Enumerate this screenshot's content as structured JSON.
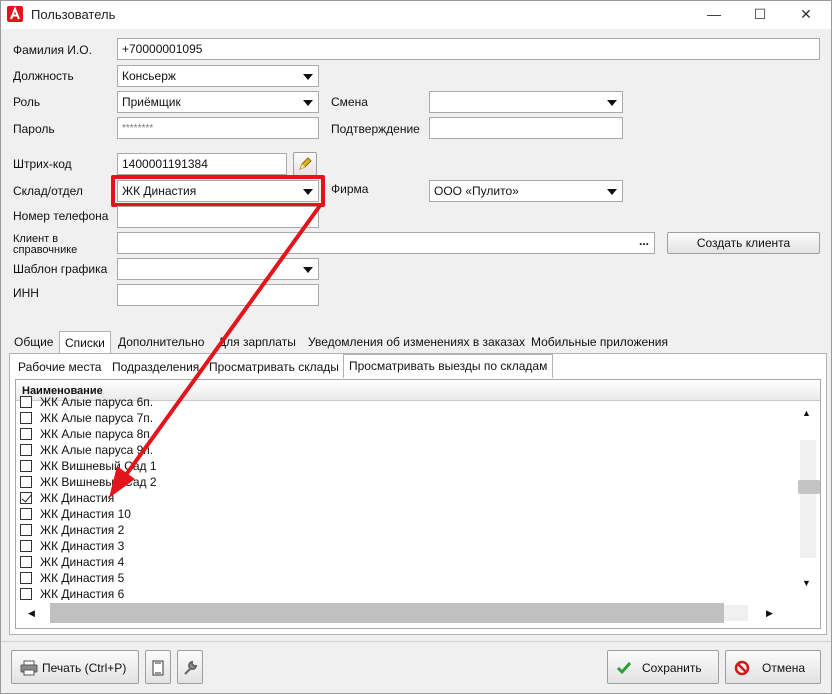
{
  "window": {
    "title": "Пользователь",
    "minimize_glyph": "—",
    "maximize_glyph": "☐",
    "close_glyph": "✕",
    "app_icon": "app-logo-icon"
  },
  "form": {
    "fio_label": "Фамилия И.О.",
    "fio_value": "+70000001095",
    "position_label": "Должность",
    "position_value": "Консьерж",
    "role_label": "Роль",
    "role_value": "Приёмщик",
    "shift_label": "Смена",
    "shift_value": "",
    "password_label": "Пароль",
    "password_value": "********",
    "confirm_label": "Подтверждение",
    "confirm_value": "",
    "barcode_label": "Штрих-код",
    "barcode_value": "1400001191384",
    "warehouse_label": "Склад/отдел",
    "warehouse_value": "ЖК Династия",
    "firm_label": "Фирма",
    "firm_value": "ООО «Пулито»",
    "phone_label": "Номер телефона",
    "phone_value": "",
    "client_label": "Клиент в справочнике",
    "client_value": "",
    "client_ellipsis": "...",
    "create_client_label": "Создать клиента",
    "schedule_label": "Шаблон графика",
    "schedule_value": "",
    "inn_label": "ИНН",
    "inn_value": ""
  },
  "tabs": [
    "Общие",
    "Списки",
    "Дополнительно",
    "Для зарплаты",
    "Уведомления об изменениях в заказах",
    "Мобильные приложения"
  ],
  "active_tab": "Списки",
  "subtabs": [
    "Рабочие места",
    "Подразделения",
    "Просматривать склады",
    "Просматривать выезды по складам"
  ],
  "active_subtab": "Просматривать выезды по складам",
  "list": {
    "header": "Наименование",
    "rows": [
      {
        "label": "ЖК Алые паруса 6п.",
        "checked": false
      },
      {
        "label": "ЖК Алые паруса 7п.",
        "checked": false
      },
      {
        "label": "ЖК Алые паруса 8п.",
        "checked": false
      },
      {
        "label": "ЖК Алые паруса 9п.",
        "checked": false
      },
      {
        "label": "ЖК Вишневый Сад 1",
        "checked": false
      },
      {
        "label": "ЖК Вишневый Сад 2",
        "checked": false
      },
      {
        "label": "ЖК Династия",
        "checked": true
      },
      {
        "label": "ЖК Династия 10",
        "checked": false
      },
      {
        "label": "ЖК Династия 2",
        "checked": false
      },
      {
        "label": "ЖК Династия 3",
        "checked": false
      },
      {
        "label": "ЖК Династия 4",
        "checked": false
      },
      {
        "label": "ЖК Династия 5",
        "checked": false
      },
      {
        "label": "ЖК Династия 6",
        "checked": false
      }
    ],
    "scroll_up": "▲",
    "scroll_down": "▼",
    "scroll_left": "◀",
    "scroll_right": "▶"
  },
  "footer": {
    "print_label": "Печать (Ctrl+P)",
    "save_label": "Сохранить",
    "cancel_label": "Отмена"
  },
  "colors": {
    "highlight": "#e3141b",
    "arrow": "#e3141b",
    "save_check": "#2e9e3a",
    "cancel_icon": "#d11a1a"
  }
}
